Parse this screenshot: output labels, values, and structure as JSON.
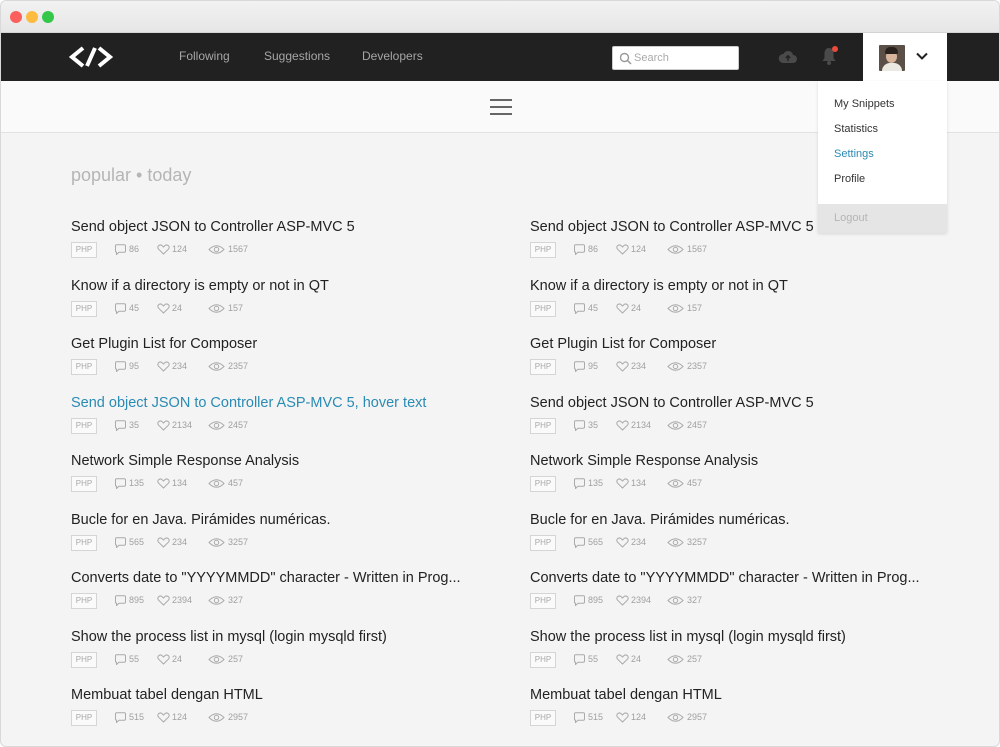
{
  "nav": {
    "links": [
      "Following",
      "Suggestions",
      "Developers"
    ],
    "search_placeholder": "Search",
    "notification_color": "#e94b3c"
  },
  "dropdown": {
    "items": [
      "My Snippets",
      "Statistics",
      "Settings",
      "Profile"
    ],
    "active_item": "Settings",
    "logout": "Logout"
  },
  "section": {
    "title": "popular • today"
  },
  "colors": {
    "accent": "#2a8bb3",
    "navbar": "#212121"
  },
  "snippets": {
    "left": [
      {
        "title": "Send object JSON to Controller ASP-MVC 5",
        "lang": "PHP",
        "comments": "86",
        "likes": "124",
        "views": "1567"
      },
      {
        "title": "Know if a directory is empty or not in QT",
        "lang": "PHP",
        "comments": "45",
        "likes": "24",
        "views": "157"
      },
      {
        "title": "Get Plugin List for Composer",
        "lang": "PHP",
        "comments": "95",
        "likes": "234",
        "views": "2357"
      },
      {
        "title": "Send object JSON to Controller ASP-MVC 5, hover text",
        "lang": "PHP",
        "comments": "35",
        "likes": "2134",
        "views": "2457"
      },
      {
        "title": "Network Simple Response Analysis",
        "lang": "PHP",
        "comments": "135",
        "likes": "134",
        "views": "457"
      },
      {
        "title": "Bucle for en Java. Pirámides numéricas.",
        "lang": "PHP",
        "comments": "565",
        "likes": "234",
        "views": "3257"
      },
      {
        "title": "Converts date to \"YYYYMMDD\" character - Written in Prog...",
        "lang": "PHP",
        "comments": "895",
        "likes": "2394",
        "views": "327"
      },
      {
        "title": "Show the process list in mysql (login mysqld first)",
        "lang": "PHP",
        "comments": "55",
        "likes": "24",
        "views": "257"
      },
      {
        "title": "Membuat tabel dengan HTML",
        "lang": "PHP",
        "comments": "515",
        "likes": "124",
        "views": "2957"
      }
    ],
    "right": [
      {
        "title": "Send object JSON to Controller ASP-MVC 5",
        "lang": "PHP",
        "comments": "86",
        "likes": "124",
        "views": "1567"
      },
      {
        "title": "Know if a directory is empty or not in QT",
        "lang": "PHP",
        "comments": "45",
        "likes": "24",
        "views": "157"
      },
      {
        "title": "Get Plugin List for Composer",
        "lang": "PHP",
        "comments": "95",
        "likes": "234",
        "views": "2357"
      },
      {
        "title": "Send object JSON to Controller ASP-MVC 5",
        "lang": "PHP",
        "comments": "35",
        "likes": "2134",
        "views": "2457"
      },
      {
        "title": "Network Simple Response Analysis",
        "lang": "PHP",
        "comments": "135",
        "likes": "134",
        "views": "457"
      },
      {
        "title": "Bucle for en Java. Pirámides numéricas.",
        "lang": "PHP",
        "comments": "565",
        "likes": "234",
        "views": "3257"
      },
      {
        "title": "Converts date to \"YYYYMMDD\" character - Written in Prog...",
        "lang": "PHP",
        "comments": "895",
        "likes": "2394",
        "views": "327"
      },
      {
        "title": "Show the process list in mysql (login mysqld first)",
        "lang": "PHP",
        "comments": "55",
        "likes": "24",
        "views": "257"
      },
      {
        "title": "Membuat tabel dengan HTML",
        "lang": "PHP",
        "comments": "515",
        "likes": "124",
        "views": "2957"
      }
    ]
  }
}
